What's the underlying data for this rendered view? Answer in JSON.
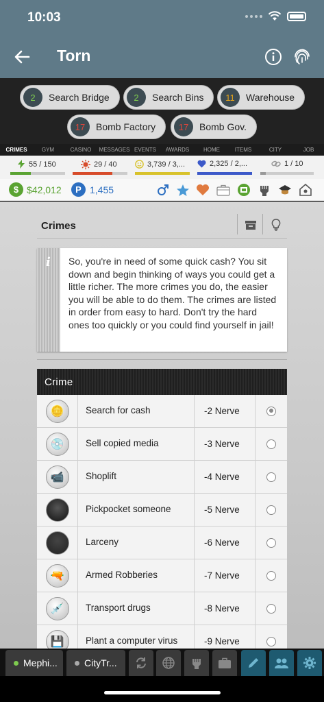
{
  "status": {
    "time": "10:03"
  },
  "appbar": {
    "title": "Torn"
  },
  "quicklinks": [
    {
      "count": "2",
      "label": "Search Bridge",
      "color": "green"
    },
    {
      "count": "2",
      "label": "Search Bins",
      "color": "green"
    },
    {
      "count": "11",
      "label": "Warehouse",
      "color": "orange"
    },
    {
      "count": "17",
      "label": "Bomb Factory",
      "color": "red"
    },
    {
      "count": "17",
      "label": "Bomb Gov.",
      "color": "red"
    }
  ],
  "nav_tabs": [
    "CRIMES",
    "GYM",
    "CASINO",
    "MESSAGES",
    "EVENTS",
    "AWARDS",
    "HOME",
    "ITEMS",
    "CITY",
    "JOB"
  ],
  "stats": [
    {
      "icon": "energy-icon",
      "text": "55 / 150",
      "fill": 0.37,
      "color": "#5aa332"
    },
    {
      "icon": "nerve-icon",
      "text": "29 / 40",
      "fill": 0.72,
      "color": "#d74b2a"
    },
    {
      "icon": "happy-icon",
      "text": "3,739 / 3,...",
      "fill": 1.0,
      "color": "#d8c22b"
    },
    {
      "icon": "life-icon",
      "text": "2,325 / 2,...",
      "fill": 1.0,
      "color": "#3c59c9"
    },
    {
      "icon": "chain-icon",
      "text": "1 / 10",
      "fill": 0.1,
      "color": "#999999"
    }
  ],
  "money": {
    "cash": "$42,012",
    "points": "1,455"
  },
  "panel": {
    "title": "Crimes"
  },
  "info_text": "So, you're in need of some quick cash? You sit down and begin thinking of ways you could get a little richer. The more crimes you do, the easier you will be able to do them. The crimes are listed in order from easy to hard. Don't try the hard ones too quickly or you could find yourself in jail!",
  "crimes_header": "Crime",
  "crimes": [
    {
      "name": "Search for cash",
      "nerve": "-2 Nerve",
      "icon": "coins-icon",
      "selected": true
    },
    {
      "name": "Sell copied media",
      "nerve": "-3 Nerve",
      "icon": "disc-icon",
      "selected": false
    },
    {
      "name": "Shoplift",
      "nerve": "-4 Nerve",
      "icon": "camera-icon",
      "selected": false
    },
    {
      "name": "Pickpocket someone",
      "nerve": "-5 Nerve",
      "icon": "hooded-figure-icon",
      "selected": false
    },
    {
      "name": "Larceny",
      "nerve": "-6 Nerve",
      "icon": "balaclava-icon",
      "selected": false
    },
    {
      "name": "Armed Robberies",
      "nerve": "-7 Nerve",
      "icon": "rifle-icon",
      "selected": false
    },
    {
      "name": "Transport drugs",
      "nerve": "-8 Nerve",
      "icon": "syringe-icon",
      "selected": false
    },
    {
      "name": "Plant a computer virus",
      "nerve": "-9 Nerve",
      "icon": "floppy-disk-icon",
      "selected": false
    }
  ],
  "chat": {
    "tab1": "Mephi...",
    "tab2": "CityTr..."
  }
}
